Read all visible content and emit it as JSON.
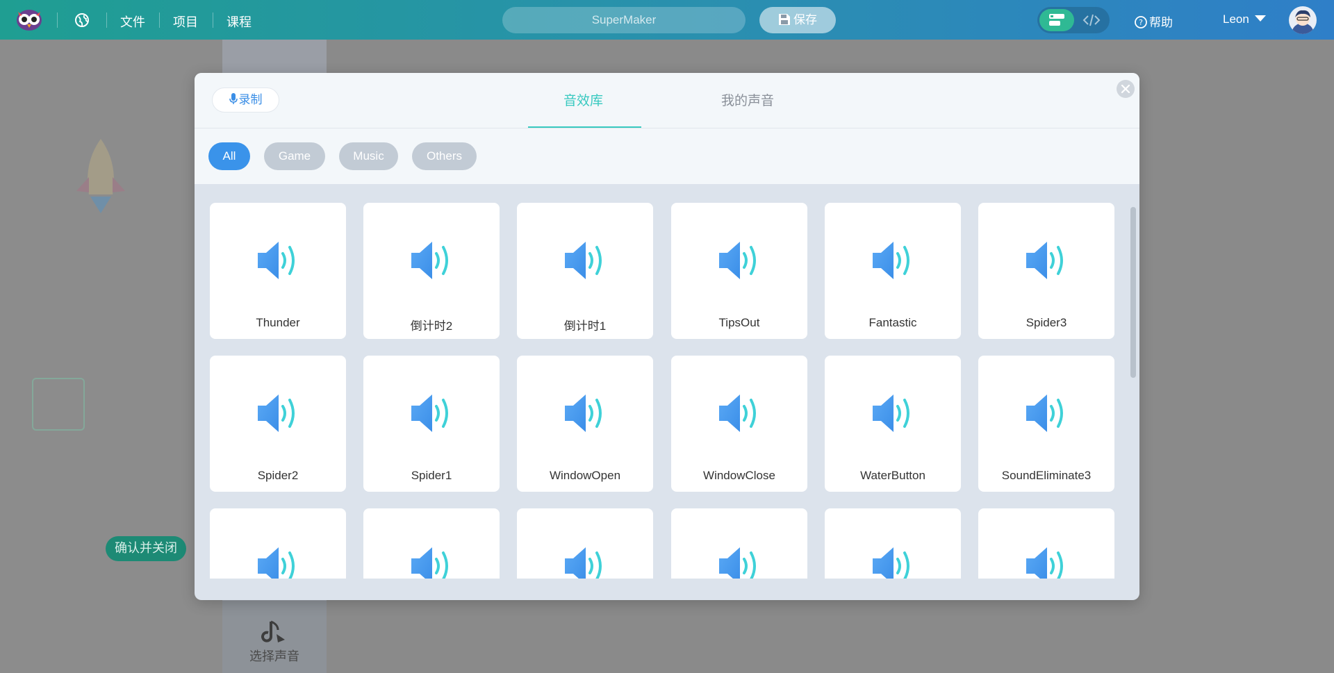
{
  "topbar": {
    "menu": [
      "文件",
      "项目",
      "课程"
    ],
    "project_name": "SuperMaker",
    "save_label": "保存",
    "help_label": "帮助",
    "user_name": "Leon"
  },
  "background": {
    "confirm_label": "确认并关闭",
    "pick_sound_label": "选择声音"
  },
  "modal": {
    "record_label": "录制",
    "tabs": [
      {
        "label": "音效库",
        "active": true
      },
      {
        "label": "我的声音",
        "active": false
      }
    ],
    "filters": [
      {
        "label": "All",
        "active": true
      },
      {
        "label": "Game",
        "active": false
      },
      {
        "label": "Music",
        "active": false
      },
      {
        "label": "Others",
        "active": false
      }
    ],
    "sounds": [
      "Thunder",
      "倒计时2",
      "倒计时1",
      "TipsOut",
      "Fantastic",
      "Spider3",
      "Spider2",
      "Spider1",
      "WindowOpen",
      "WindowClose",
      "WaterButton",
      "SoundEliminate3",
      "",
      "",
      "",
      "",
      "",
      ""
    ]
  },
  "colors": {
    "accent_teal": "#38c9c0",
    "accent_blue": "#3a93ea",
    "speaker_blue": "#4a9ff0",
    "speaker_waves": "#3fd1d8"
  },
  "icons": [
    "owl-logo-icon",
    "globe-icon",
    "save-icon",
    "blocks-mode-icon",
    "code-mode-icon",
    "help-icon",
    "caret-down-icon",
    "avatar-icon",
    "microphone-icon",
    "close-icon",
    "speaker-icon",
    "music-note-icon"
  ]
}
